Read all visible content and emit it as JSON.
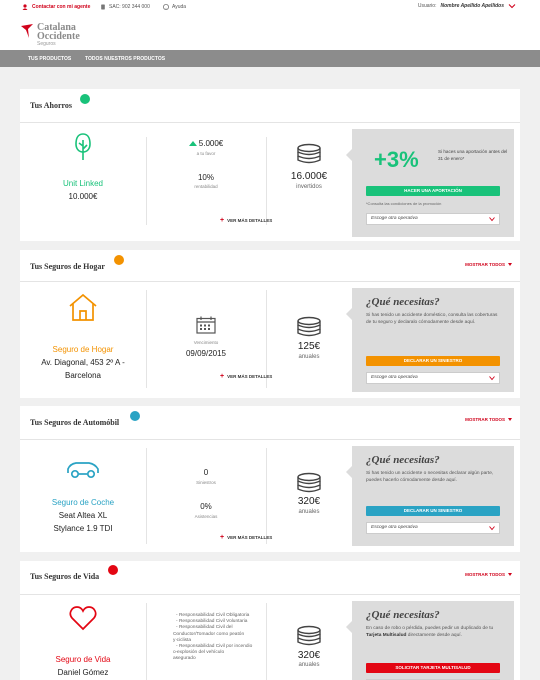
{
  "topbar": {
    "agent_label": "Contactar con mi agente",
    "sac_label": "SAC: 902 344 000",
    "help_label": "Ayuda",
    "user_prefix": "Usuario:",
    "user_name": "Nombre Apellido Apellidos"
  },
  "header": {
    "logo_line1": "Catalana",
    "logo_line2": "Occidente",
    "logo_line3": "Seguros"
  },
  "nav": {
    "items": [
      {
        "label": "TUS PRODUCTOS"
      },
      {
        "label": "TODOS NUESTROS PRODUCTOS"
      }
    ]
  },
  "common": {
    "details_label": "VER MÁS DETALLES",
    "show_all_label": "MOSTRAR TODOS",
    "need_title": "¿Qué necesitas?",
    "select_placeholder": "Escoge otra operativa"
  },
  "savings": {
    "title": "Tus Ahorros",
    "dot_color": "#19c27a",
    "product_name": "Unit Linked",
    "product_amount": "10.000€",
    "favor_value": "5.000€",
    "favor_label": "a tu favor",
    "rent_value": "10%",
    "rent_label": "rentabilidad",
    "invested_value": "16.000€",
    "invested_label": "invertidos",
    "promo_big": "+3%",
    "promo_text": "Si haces una aportación antes del 31 de enero*",
    "promo_button": "HACER UNA APORTACIÓN",
    "promo_note": "*Consulta las condiciones de la promoción",
    "accent": "#19c27a"
  },
  "home": {
    "title": "Tus Seguros de Hogar",
    "dot_color": "#f39200",
    "product_name": "Seguro de Hogar",
    "address_line1": "Av. Diagonal, 453 2º A -",
    "address_line2": "Barcelona",
    "due_label": "Vencimiento",
    "due_date": "09/09/2015",
    "price": "125€",
    "price_label": "anuales",
    "need_text": "Si has tenido un accidente doméstico, consulta las coberturas de tu seguro y declaralo cómodamente desde aquí.",
    "button": "DECLARAR UN SINIESTRO",
    "accent": "#f39200"
  },
  "car": {
    "title": "Tus Seguros de Automóbil",
    "dot_color": "#2aa3c4",
    "product_name": "Seguro de Coche",
    "model_line1": "Seat Altea XL",
    "model_line2": "Stylance 1.9 TDI",
    "claims_value": "0",
    "claims_label": "Siniestros",
    "assist_value": "0%",
    "assist_label": "Asistencias",
    "price": "320€",
    "price_label": "anuales",
    "need_text": "Si has tenido un accidente o necesitas declarar algún parte, puedes hacerlo cómodamente desde aquí.",
    "button": "DECLARAR UN SINIESTRO",
    "accent": "#2aa3c4"
  },
  "life": {
    "title": "Tus Seguros de Vida",
    "dot_color": "#e30613",
    "product_name": "Seguro de Vida",
    "holder": "Daniel Gómez",
    "coverages": [
      "Responsabilidad Civil Obligatoria",
      "Responsabilidad Civil Voluntaria",
      "Responsabilidad Civil del",
      "Conductor/Tomador como peatón",
      "y ciclista",
      "Responsabilidad Civil por incendio",
      "o explosión del vehículo",
      "asegurado"
    ],
    "price": "320€",
    "price_label": "anuales",
    "need_text_a": "En caso de robo o pérdida, puedes pedir un duplicado de tu",
    "need_text_b": "Tarjeta Multisalud",
    "need_text_c": "directamente desde aquí.",
    "button": "SOLICITAR TARJETA MULTISALUD",
    "accent": "#e30613"
  }
}
